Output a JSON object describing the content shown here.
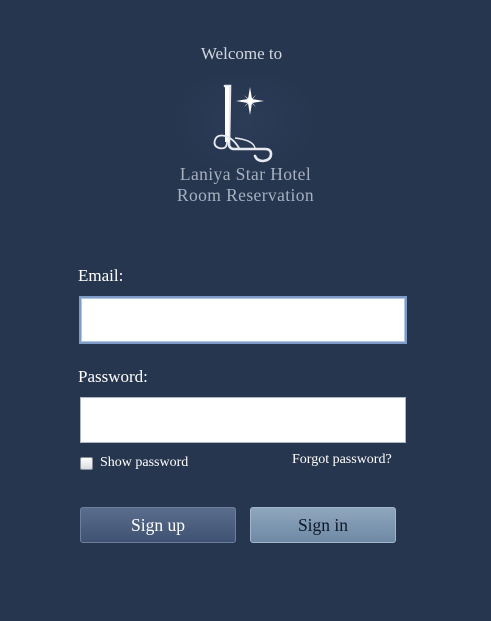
{
  "header": {
    "welcome": "Welcome to",
    "hotel_name": "Laniya Star Hotel",
    "subtitle": "Room Reservation",
    "logo_icon": "star-l-monogram-icon"
  },
  "form": {
    "email_label": "Email:",
    "email_value": "",
    "password_label": "Password:",
    "password_value": "",
    "show_password_label": "Show password",
    "show_password_checked": false,
    "forgot_password_label": "Forgot password?"
  },
  "buttons": {
    "signup_label": "Sign up",
    "signin_label": "Sign in"
  },
  "colors": {
    "background": "#27364f",
    "signup_button": "#4a5c7c",
    "signin_button": "#7e97b1",
    "logo_text": "#a6b0c0"
  }
}
